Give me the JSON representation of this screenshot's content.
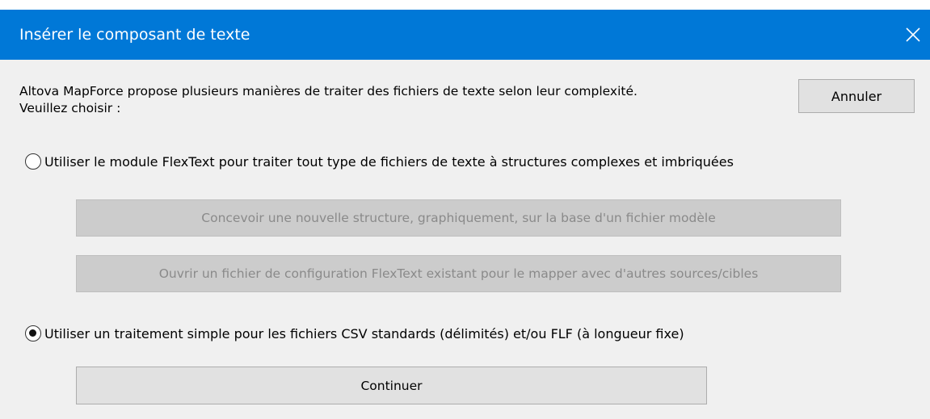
{
  "window": {
    "title": "Insérer le composant de texte"
  },
  "description": {
    "line1": "Altova MapForce propose plusieurs manières de traiter des fichiers de texte selon leur complexité.",
    "line2": "Veuillez choisir :"
  },
  "buttons": {
    "cancel_label": "Annuler",
    "design_structure_label": "Concevoir une nouvelle structure, graphiquement, sur la base d'un fichier modèle",
    "open_config_label": "Ouvrir un fichier de configuration FlexText existant pour le mapper avec d'autres sources/cibles",
    "continue_label": "Continuer"
  },
  "options": [
    {
      "label": "Utiliser le module FlexText pour traiter tout type de fichiers de texte à structures complexes et imbriquées",
      "selected": false
    },
    {
      "label": "Utiliser un traitement simple pour les fichiers CSV standards (délimités) et/ou FLF (à longueur fixe)",
      "selected": true
    }
  ],
  "colors": {
    "title_bar": "#0078d7",
    "dialog_background": "#f0f0f0",
    "disabled_button": "#cccccc",
    "button": "#e1e1e1"
  }
}
